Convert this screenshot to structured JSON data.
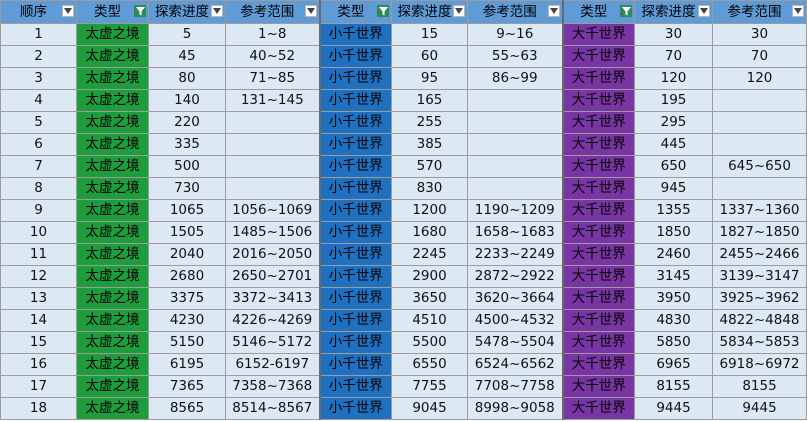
{
  "colors": {
    "header": "#5f9bd6",
    "row": "#dde8f5",
    "taixu": "#1e9d3c",
    "xiaoqian": "#1f70c0",
    "daqian": "#7a35a5"
  },
  "headers": [
    "顺序",
    "类型",
    "探索进度",
    "参考范围",
    "类型",
    "探索进度",
    "参考范围",
    "类型",
    "探索进度",
    "参考范围"
  ],
  "type_labels": {
    "taixu": "太虚之境",
    "xiaoqian": "小千世界",
    "daqian": "大千世界"
  },
  "icons": {
    "filter_dropdown": "filter-dropdown-icon",
    "filter_active": "filter-active-icon"
  },
  "rows": [
    {
      "seq": "1",
      "t1": "太虚之境",
      "p1": "5",
      "r1": "1~8",
      "t2": "小千世界",
      "p2": "15",
      "r2": "9~16",
      "t3": "大千世界",
      "p3": "30",
      "r3": "30"
    },
    {
      "seq": "2",
      "t1": "太虚之境",
      "p1": "45",
      "r1": "40~52",
      "t2": "小千世界",
      "p2": "60",
      "r2": "55~63",
      "t3": "大千世界",
      "p3": "70",
      "r3": "70"
    },
    {
      "seq": "3",
      "t1": "太虚之境",
      "p1": "80",
      "r1": "71~85",
      "t2": "小千世界",
      "p2": "95",
      "r2": "86~99",
      "t3": "大千世界",
      "p3": "120",
      "r3": "120"
    },
    {
      "seq": "4",
      "t1": "太虚之境",
      "p1": "140",
      "r1": "131~145",
      "t2": "小千世界",
      "p2": "165",
      "r2": "",
      "t3": "大千世界",
      "p3": "195",
      "r3": ""
    },
    {
      "seq": "5",
      "t1": "太虚之境",
      "p1": "220",
      "r1": "",
      "t2": "小千世界",
      "p2": "255",
      "r2": "",
      "t3": "大千世界",
      "p3": "295",
      "r3": ""
    },
    {
      "seq": "6",
      "t1": "太虚之境",
      "p1": "335",
      "r1": "",
      "t2": "小千世界",
      "p2": "385",
      "r2": "",
      "t3": "大千世界",
      "p3": "445",
      "r3": ""
    },
    {
      "seq": "7",
      "t1": "太虚之境",
      "p1": "500",
      "r1": "",
      "t2": "小千世界",
      "p2": "570",
      "r2": "",
      "t3": "大千世界",
      "p3": "650",
      "r3": "645~650"
    },
    {
      "seq": "8",
      "t1": "太虚之境",
      "p1": "730",
      "r1": "",
      "t2": "小千世界",
      "p2": "830",
      "r2": "",
      "t3": "大千世界",
      "p3": "945",
      "r3": ""
    },
    {
      "seq": "9",
      "t1": "太虚之境",
      "p1": "1065",
      "r1": "1056~1069",
      "t2": "小千世界",
      "p2": "1200",
      "r2": "1190~1209",
      "t3": "大千世界",
      "p3": "1355",
      "r3": "1337~1360"
    },
    {
      "seq": "10",
      "t1": "太虚之境",
      "p1": "1505",
      "r1": "1485~1506",
      "t2": "小千世界",
      "p2": "1680",
      "r2": "1658~1683",
      "t3": "大千世界",
      "p3": "1850",
      "r3": "1827~1850"
    },
    {
      "seq": "11",
      "t1": "太虚之境",
      "p1": "2040",
      "r1": "2016~2050",
      "t2": "小千世界",
      "p2": "2245",
      "r2": "2233~2249",
      "t3": "大千世界",
      "p3": "2460",
      "r3": "2455~2466"
    },
    {
      "seq": "12",
      "t1": "太虚之境",
      "p1": "2680",
      "r1": "2650~2701",
      "t2": "小千世界",
      "p2": "2900",
      "r2": "2872~2922",
      "t3": "大千世界",
      "p3": "3145",
      "r3": "3139~3147"
    },
    {
      "seq": "13",
      "t1": "太虚之境",
      "p1": "3375",
      "r1": "3372~3413",
      "t2": "小千世界",
      "p2": "3650",
      "r2": "3620~3664",
      "t3": "大千世界",
      "p3": "3950",
      "r3": "3925~3962"
    },
    {
      "seq": "14",
      "t1": "太虚之境",
      "p1": "4230",
      "r1": "4226~4269",
      "t2": "小千世界",
      "p2": "4510",
      "r2": "4500~4532",
      "t3": "大千世界",
      "p3": "4830",
      "r3": "4822~4848"
    },
    {
      "seq": "15",
      "t1": "太虚之境",
      "p1": "5150",
      "r1": "5146~5172",
      "t2": "小千世界",
      "p2": "5500",
      "r2": "5478~5504",
      "t3": "大千世界",
      "p3": "5850",
      "r3": "5834~5853"
    },
    {
      "seq": "16",
      "t1": "太虚之境",
      "p1": "6195",
      "r1": "6152-6197",
      "t2": "小千世界",
      "p2": "6550",
      "r2": "6524~6562",
      "t3": "大千世界",
      "p3": "6965",
      "r3": "6918~6972"
    },
    {
      "seq": "17",
      "t1": "太虚之境",
      "p1": "7365",
      "r1": "7358~7368",
      "t2": "小千世界",
      "p2": "7755",
      "r2": "7708~7758",
      "t3": "大千世界",
      "p3": "8155",
      "r3": "8155"
    },
    {
      "seq": "18",
      "t1": "太虚之境",
      "p1": "8565",
      "r1": "8514~8567",
      "t2": "小千世界",
      "p2": "9045",
      "r2": "8998~9058",
      "t3": "大千世界",
      "p3": "9445",
      "r3": "9445"
    }
  ]
}
